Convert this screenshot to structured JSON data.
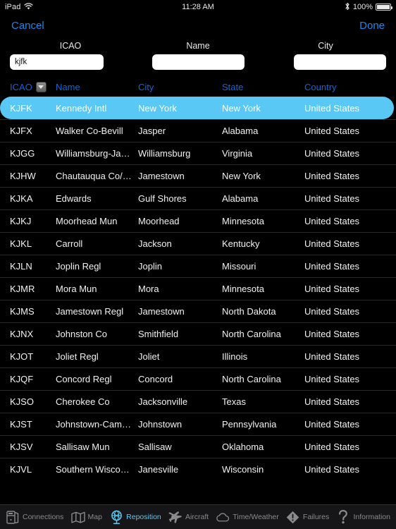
{
  "statusbar": {
    "device": "iPad",
    "wifi_icon": "wifi-icon",
    "time": "11:28 AM",
    "bluetooth_icon": "bluetooth-icon",
    "battery_percent": "100%"
  },
  "navbar": {
    "cancel_label": "Cancel",
    "done_label": "Done"
  },
  "filters": [
    {
      "label": "ICAO",
      "value": "kjfk",
      "placeholder": ""
    },
    {
      "label": "Name",
      "value": "",
      "placeholder": ""
    },
    {
      "label": "City",
      "value": "",
      "placeholder": ""
    }
  ],
  "table": {
    "columns": [
      {
        "label": "ICAO",
        "sorted": true,
        "sort_icon": "sort-descending-icon"
      },
      {
        "label": "Name",
        "sorted": false
      },
      {
        "label": "City",
        "sorted": false
      },
      {
        "label": "State",
        "sorted": false
      },
      {
        "label": "Country",
        "sorted": false
      }
    ],
    "selected_row_color": "#5ac8f5",
    "header_color": "#1565d8",
    "rows": [
      {
        "icao": "KJFK",
        "name": "Kennedy Intl",
        "city": "New York",
        "state": "New York",
        "country": "United States",
        "selected": true
      },
      {
        "icao": "KJFX",
        "name": "Walker Co-Bevill",
        "city": "Jasper",
        "state": "Alabama",
        "country": "United States",
        "selected": false
      },
      {
        "icao": "KJGG",
        "name": "Williamsburg-Jam…",
        "city": "Williamsburg",
        "state": "Virginia",
        "country": "United States",
        "selected": false
      },
      {
        "icao": "KJHW",
        "name": "Chautauqua Co/Ja…",
        "city": "Jamestown",
        "state": "New York",
        "country": "United States",
        "selected": false
      },
      {
        "icao": "KJKA",
        "name": "Edwards",
        "city": "Gulf Shores",
        "state": "Alabama",
        "country": "United States",
        "selected": false
      },
      {
        "icao": "KJKJ",
        "name": "Moorhead Mun",
        "city": "Moorhead",
        "state": "Minnesota",
        "country": "United States",
        "selected": false
      },
      {
        "icao": "KJKL",
        "name": "Carroll",
        "city": "Jackson",
        "state": "Kentucky",
        "country": "United States",
        "selected": false
      },
      {
        "icao": "KJLN",
        "name": "Joplin Regl",
        "city": "Joplin",
        "state": "Missouri",
        "country": "United States",
        "selected": false
      },
      {
        "icao": "KJMR",
        "name": "Mora Mun",
        "city": "Mora",
        "state": "Minnesota",
        "country": "United States",
        "selected": false
      },
      {
        "icao": "KJMS",
        "name": "Jamestown Regl",
        "city": "Jamestown",
        "state": "North Dakota",
        "country": "United States",
        "selected": false
      },
      {
        "icao": "KJNX",
        "name": "Johnston Co",
        "city": "Smithfield",
        "state": "North Carolina",
        "country": "United States",
        "selected": false
      },
      {
        "icao": "KJOT",
        "name": "Joliet Regl",
        "city": "Joliet",
        "state": "Illinois",
        "country": "United States",
        "selected": false
      },
      {
        "icao": "KJQF",
        "name": "Concord Regl",
        "city": "Concord",
        "state": "North Carolina",
        "country": "United States",
        "selected": false
      },
      {
        "icao": "KJSO",
        "name": "Cherokee Co",
        "city": "Jacksonville",
        "state": "Texas",
        "country": "United States",
        "selected": false
      },
      {
        "icao": "KJST",
        "name": "Johnstown-Camb…",
        "city": "Johnstown",
        "state": "Pennsylvania",
        "country": "United States",
        "selected": false
      },
      {
        "icao": "KJSV",
        "name": "Sallisaw Mun",
        "city": "Sallisaw",
        "state": "Oklahoma",
        "country": "United States",
        "selected": false
      },
      {
        "icao": "KJVL",
        "name": "Southern Wiscons…",
        "city": "Janesville",
        "state": "Wisconsin",
        "country": "United States",
        "selected": false
      }
    ]
  },
  "tabbar": {
    "active_color": "#5ac8f5",
    "inactive_color": "#8a8a8d",
    "items": [
      {
        "label": "Connections",
        "icon": "server-icon",
        "active": false
      },
      {
        "label": "Map",
        "icon": "map-icon",
        "active": false
      },
      {
        "label": "Reposition",
        "icon": "globe-icon",
        "active": true
      },
      {
        "label": "Aircraft",
        "icon": "airplane-icon",
        "active": false
      },
      {
        "label": "Time/Weather",
        "icon": "cloud-icon",
        "active": false
      },
      {
        "label": "Failures",
        "icon": "warning-diamond-icon",
        "active": false
      },
      {
        "label": "Information",
        "icon": "question-mark-icon",
        "active": false
      }
    ]
  }
}
